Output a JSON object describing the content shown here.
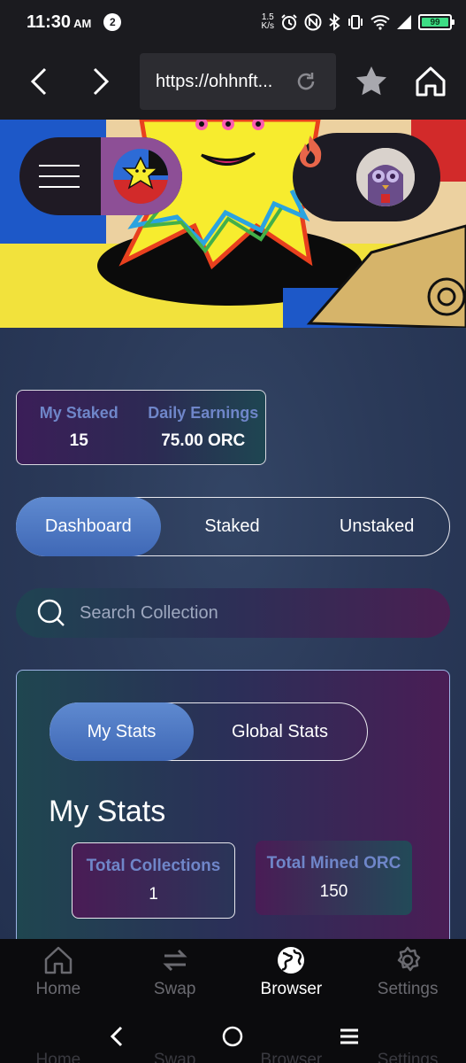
{
  "status_bar": {
    "time": "11:30",
    "ampm": "AM",
    "notification_count": "2",
    "net_speed_value": "1.5",
    "net_speed_unit": "K/s",
    "battery_level": "99",
    "icons": [
      "alarm-icon",
      "nfc-icon",
      "bluetooth-icon",
      "vibrate-icon",
      "wifi-icon",
      "signal-icon",
      "battery-icon"
    ]
  },
  "browser": {
    "url": "https://ohhnft...",
    "icons": [
      "back-icon",
      "forward-icon",
      "reload-icon",
      "star-icon",
      "home-icon"
    ]
  },
  "header": {
    "icons": [
      "hamburger-icon",
      "flame-icon"
    ]
  },
  "summary": {
    "staked_label": "My Staked",
    "staked_value": "15",
    "earnings_label": "Daily Earnings",
    "earnings_value": "75.00 ORC"
  },
  "tabs": {
    "items": [
      "Dashboard",
      "Staked",
      "Unstaked"
    ],
    "active": "Dashboard"
  },
  "search": {
    "placeholder": "Search Collection",
    "value": ""
  },
  "stats": {
    "sub_tabs": [
      "My Stats",
      "Global Stats"
    ],
    "active_sub_tab": "My Stats",
    "heading": "My Stats",
    "total_collections_label": "Total Collections",
    "total_collections_value": "1",
    "total_mined_label": "Total Mined ORC",
    "total_mined_value": "150"
  },
  "bottom_nav": {
    "items": [
      "Home",
      "Swap",
      "Browser",
      "Settings"
    ],
    "active": "Browser"
  },
  "colors": {
    "accent_blue": "#4f78c4",
    "label_blue": "#6f86c9",
    "battery_green": "#3ddc84"
  }
}
